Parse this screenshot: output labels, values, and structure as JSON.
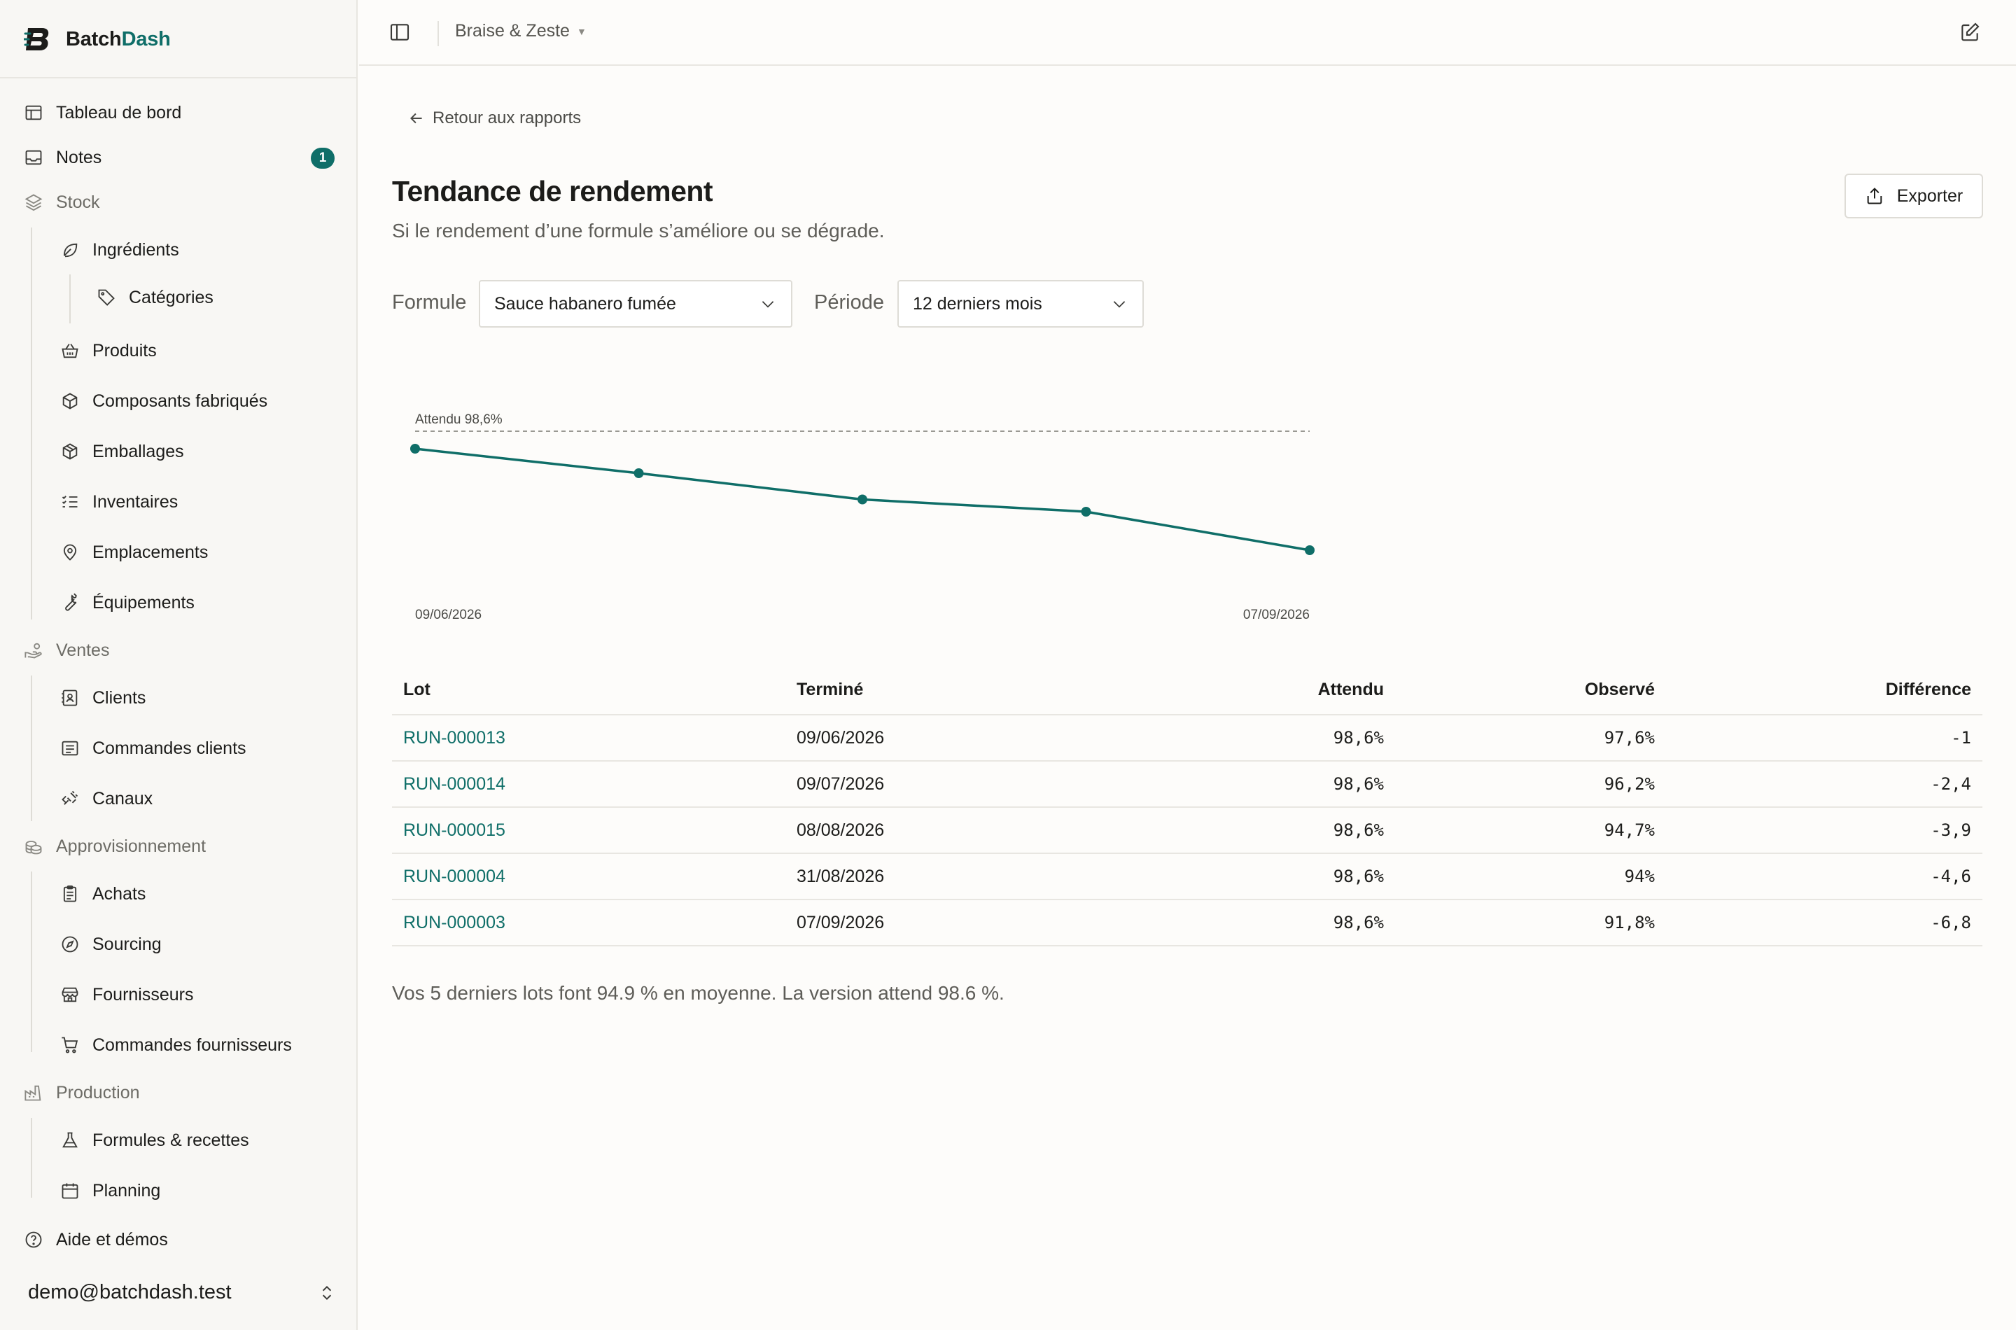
{
  "app": {
    "name_part1": "Batch",
    "name_part2": "Dash"
  },
  "header": {
    "organization": "Braise & Zeste"
  },
  "sidebar": {
    "items": [
      {
        "label": "Tableau de bord"
      },
      {
        "label": "Notes",
        "badge": "1"
      },
      {
        "label": "Stock"
      },
      {
        "label": "Ingrédients"
      },
      {
        "label": "Catégories"
      },
      {
        "label": "Produits"
      },
      {
        "label": "Composants fabriqués"
      },
      {
        "label": "Emballages"
      },
      {
        "label": "Inventaires"
      },
      {
        "label": "Emplacements"
      },
      {
        "label": "Équipements"
      },
      {
        "label": "Ventes"
      },
      {
        "label": "Clients"
      },
      {
        "label": "Commandes clients"
      },
      {
        "label": "Canaux"
      },
      {
        "label": "Approvisionnement"
      },
      {
        "label": "Achats"
      },
      {
        "label": "Sourcing"
      },
      {
        "label": "Fournisseurs"
      },
      {
        "label": "Commandes fournisseurs"
      },
      {
        "label": "Production"
      },
      {
        "label": "Formules & recettes"
      },
      {
        "label": "Planning"
      },
      {
        "label": "Aide et démos"
      }
    ],
    "account_email": "demo@batchdash.test"
  },
  "main": {
    "back_label": "Retour aux rapports",
    "title": "Tendance de rendement",
    "subtitle": "Si le rendement d’une formule s’améliore ou se dégrade.",
    "export_label": "Exporter",
    "filters": {
      "formula_label": "Formule",
      "formula_value": "Sauce habanero fumée",
      "period_label": "Période",
      "period_value": "12 derniers mois"
    },
    "table": {
      "columns": [
        "Lot",
        "Terminé",
        "Attendu",
        "Observé",
        "Différence"
      ],
      "rows": [
        {
          "lot": "RUN-000013",
          "done": "09/06/2026",
          "expected": "98,6%",
          "observed": "97,6%",
          "diff": "-1"
        },
        {
          "lot": "RUN-000014",
          "done": "09/07/2026",
          "expected": "98,6%",
          "observed": "96,2%",
          "diff": "-2,4"
        },
        {
          "lot": "RUN-000015",
          "done": "08/08/2026",
          "expected": "98,6%",
          "observed": "94,7%",
          "diff": "-3,9"
        },
        {
          "lot": "RUN-000004",
          "done": "31/08/2026",
          "expected": "98,6%",
          "observed": "94%",
          "diff": "-4,6"
        },
        {
          "lot": "RUN-000003",
          "done": "07/09/2026",
          "expected": "98,6%",
          "observed": "91,8%",
          "diff": "-6,8"
        }
      ]
    },
    "summary": "Vos 5 derniers lots font 94.9 % en moyenne. La version attend 98.6 %."
  },
  "chart_data": {
    "type": "line",
    "x": [
      "09/06/2026",
      "09/07/2026",
      "08/08/2026",
      "31/08/2026",
      "07/09/2026"
    ],
    "x_tick_labels": [
      "09/06/2026",
      "07/09/2026"
    ],
    "series": [
      {
        "values": [
          97.6,
          96.2,
          94.7,
          94.0,
          91.8
        ]
      }
    ],
    "reference_line": {
      "value": 98.6,
      "label": "Attendu 98,6%"
    },
    "ylim": [
      91.8,
      98.6
    ],
    "grid": false,
    "color": "#0f6e68"
  }
}
